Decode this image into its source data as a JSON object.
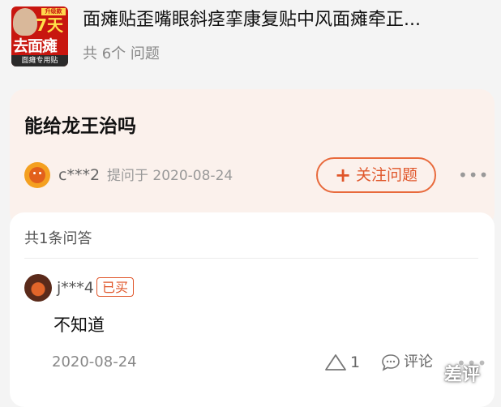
{
  "product": {
    "title": "面瘫贴歪嘴眼斜痉挛康复贴中风面瘫牵正...",
    "question_count": "共 6个 问题",
    "thumb_text": {
      "badge": "升级款",
      "days": "7天",
      "main": "去面瘫",
      "bottom": "面瘫专用贴"
    }
  },
  "question": {
    "title": "能给龙王治吗",
    "asker": "c***2",
    "asked_on": "提问于 2020-08-24",
    "follow_label": "关注问题"
  },
  "answers": {
    "count_label": "共1条问答",
    "items": [
      {
        "user": "j***4",
        "badge": "已买",
        "text": "不知道",
        "date": "2020-08-24",
        "likes": "1",
        "comment_label": "评论"
      }
    ]
  },
  "watermark": "差评",
  "colors": {
    "accent": "#e0562a",
    "card_bg": "#fbf1ec"
  },
  "icons": [
    "more-icon",
    "like-icon",
    "comment-icon",
    "plus-icon"
  ]
}
